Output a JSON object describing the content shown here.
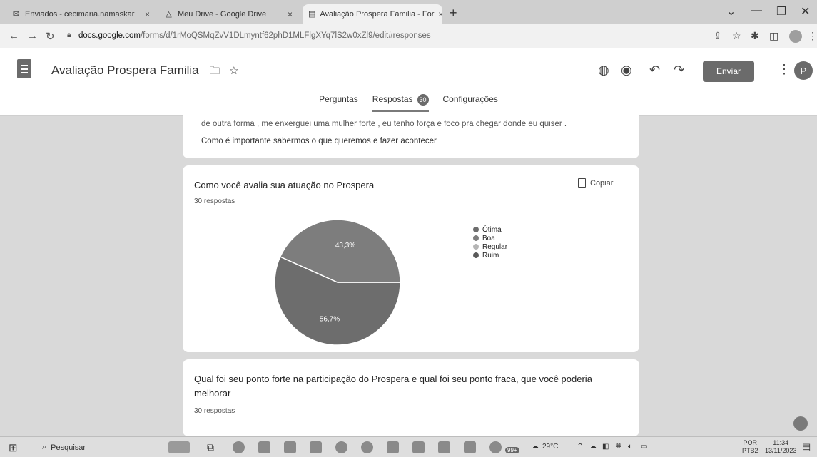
{
  "browser": {
    "tabs": [
      {
        "title": "Enviados - cecimaria.namaskar",
        "icon": "mail-icon"
      },
      {
        "title": "Meu Drive - Google Drive",
        "icon": "drive-icon"
      },
      {
        "title": "Avaliação Prospera Familia - For",
        "icon": "forms-icon"
      }
    ],
    "url": {
      "host": "docs.google.com",
      "path": "/forms/d/1rMoQSMqZvV1DLmyntf62phD1MLFlgXYq7lS2w0xZl9/edit#responses"
    }
  },
  "form": {
    "title": "Avaliação Prospera Familia",
    "send_label": "Enviar",
    "avatar_letter": "P",
    "tabs": {
      "questions": "Perguntas",
      "responses": "Respostas",
      "responses_count": "30",
      "settings": "Configurações"
    }
  },
  "cards": {
    "prev_cut_line": "de outra forma , me enxerguei uma mulher forte , eu tenho força e foco pra chegar donde eu quiser .",
    "prev_answer": "Como é importante sabermos o que queremos e fazer acontecer",
    "q1": {
      "title": "Como você avalia sua atuação no Prospera",
      "responses": "30 respostas",
      "copy_label": "Copiar"
    },
    "q2": {
      "title_line1": "Qual foi seu ponto forte na participação do Prospera e qual foi seu ponto fraca, que você poderia",
      "title_line2": "melhorar",
      "responses": "30 respostas"
    }
  },
  "chart_data": {
    "type": "pie",
    "categories": [
      "Ótima",
      "Boa",
      "Regular",
      "Ruim"
    ],
    "values": [
      56.7,
      43.3,
      0,
      0
    ],
    "data_labels": [
      "56,7%",
      "43,3%"
    ],
    "legend_placement": "right",
    "colors": [
      "#6d6d6d",
      "#7d7d7d",
      "#b5b5b5",
      "#5a5a5a"
    ]
  },
  "taskbar": {
    "search_placeholder": "Pesquisar",
    "weather": "29°C",
    "lang_line1": "POR",
    "lang_line2": "PTB2",
    "time": "11:34",
    "date": "13/11/2023",
    "notif_badge": "99+"
  }
}
